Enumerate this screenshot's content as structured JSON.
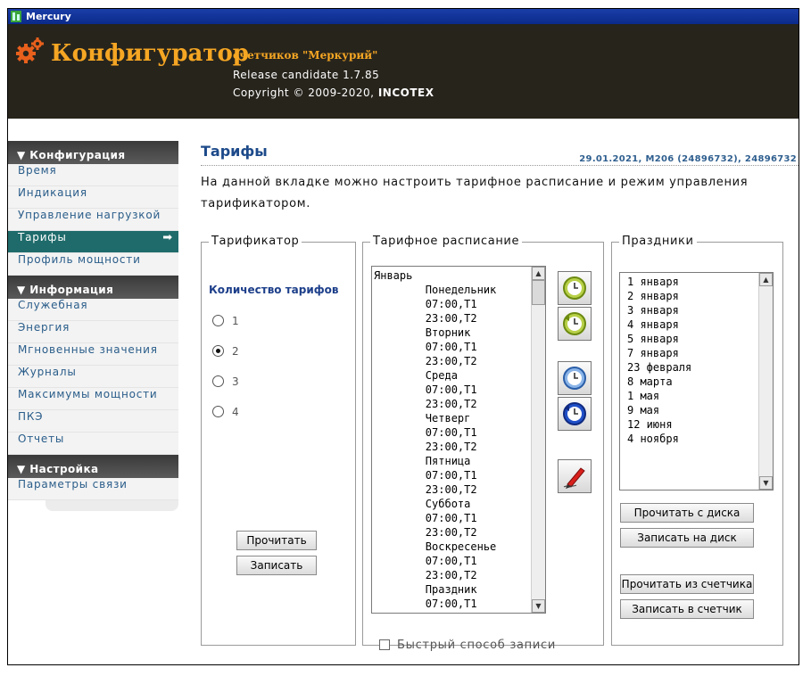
{
  "window": {
    "title": "Mercury"
  },
  "header": {
    "app_title": "Конфигуратор",
    "subtitle": "счетчиков \"Меркурий\"",
    "release": "Release candidate 1.7.85",
    "copyright_prefix": "Copyright © 2009-2020, ",
    "copyright_company": "INCOTEX"
  },
  "sidebar": {
    "sections": [
      {
        "title": "Конфигурация",
        "items": [
          "Время",
          "Индикация",
          "Управление нагрузкой",
          "Тарифы",
          "Профиль мощности"
        ]
      },
      {
        "title": "Информация",
        "items": [
          "Служебная",
          "Энергия",
          "Мгновенные значения",
          "Журналы",
          "Максимумы мощности",
          "ПКЭ",
          "Отчеты"
        ]
      },
      {
        "title": "Настройка",
        "items": [
          "Параметры связи"
        ]
      }
    ],
    "active_item": "Тарифы"
  },
  "page": {
    "title": "Тарифы",
    "meta": "29.01.2021, M206 (24896732), 24896732",
    "description": "На данной вкладке можно настроить тарифное расписание и режим управления тарификатором."
  },
  "tarifikator": {
    "legend": "Тарификатор",
    "count_label": "Количество тарифов",
    "options": [
      "1",
      "2",
      "3",
      "4"
    ],
    "selected": "2",
    "read_button": "Прочитать",
    "write_button": "Записать"
  },
  "schedule": {
    "legend": "Тарифное расписание",
    "lines": [
      "Январь",
      "        Понедельник",
      "        07:00,T1",
      "        23:00,T2",
      "        Вторник",
      "        07:00,T1",
      "        23:00,T2",
      "        Среда",
      "        07:00,T1",
      "        23:00,T2",
      "        Четверг",
      "        07:00,T1",
      "        23:00,T2",
      "        Пятница",
      "        07:00,T1",
      "        23:00,T2",
      "        Суббота",
      "        07:00,T1",
      "        23:00,T2",
      "        Воскресенье",
      "        07:00,T1",
      "        23:00,T2",
      "        Праздник",
      "        07:00,T1"
    ],
    "tool_icons": [
      "clock-read-disk-icon",
      "clock-write-disk-icon",
      "clock-read-meter-icon",
      "clock-write-meter-icon",
      "pen-edit-icon"
    ],
    "fast_write_label": "Быстрый способ записи",
    "fast_write_checked": false
  },
  "holidays": {
    "legend": "Праздники",
    "items": [
      "1 января",
      "2 января",
      "3 января",
      "4 января",
      "5 января",
      "7 января",
      "23 февраля",
      "8 марта",
      "1 мая",
      "9 мая",
      "12 июня",
      "4 ноября"
    ],
    "read_disk": "Прочитать с диска",
    "write_disk": "Записать на диск",
    "read_meter": "Прочитать из счетчика",
    "write_meter": "Записать в счетчик"
  },
  "colors": {
    "header_bg": "#27241c",
    "accent_orange": "#f5a623",
    "active_nav": "#1f6b6b",
    "title_blue": "#1d4a8a"
  }
}
